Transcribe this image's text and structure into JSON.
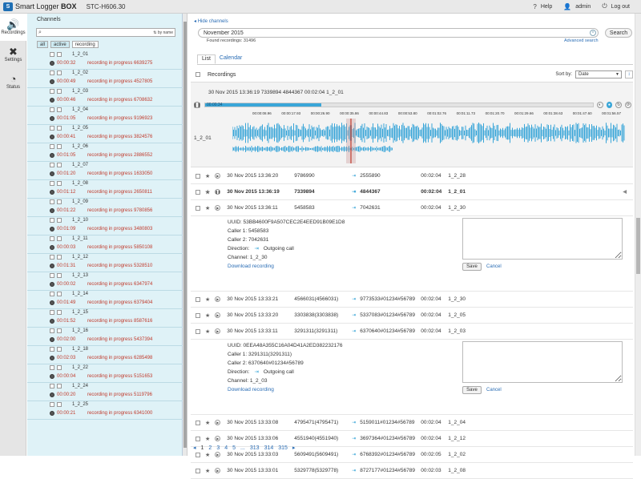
{
  "header": {
    "brand_a": "Smart Logger",
    "brand_b": "BOX",
    "model": "STC-H606.30",
    "help": "Help",
    "user": "admin",
    "logout": "Log out"
  },
  "nav": [
    {
      "label": "Recordings",
      "icon": "speaker-icon"
    },
    {
      "label": "Settings",
      "icon": "tools-icon"
    },
    {
      "label": "Status",
      "icon": "gauge-icon"
    }
  ],
  "channels": {
    "title": "Channels",
    "search_placeholder": "",
    "sort_label": "by name",
    "filters": [
      "all",
      "active",
      "recording"
    ],
    "items": [
      {
        "name": "1_2_01",
        "time": "00:00:32",
        "status": "recording in progress",
        "number": "6639275"
      },
      {
        "name": "1_2_02",
        "time": "00:00:49",
        "status": "recording in progress",
        "number": "4527805"
      },
      {
        "name": "1_2_03",
        "time": "00:00:46",
        "status": "recording in progress",
        "number": "6708632"
      },
      {
        "name": "1_2_04",
        "time": "00:01:05",
        "status": "recording in progress",
        "number": "9196923"
      },
      {
        "name": "1_2_05",
        "time": "00:00:41",
        "status": "recording in progress",
        "number": "3824576"
      },
      {
        "name": "1_2_06",
        "time": "00:01:05",
        "status": "recording in progress",
        "number": "2886552"
      },
      {
        "name": "1_2_07",
        "time": "00:01:20",
        "status": "recording in progress",
        "number": "1633050"
      },
      {
        "name": "1_2_08",
        "time": "00:01:12",
        "status": "recording in progress",
        "number": "2650811"
      },
      {
        "name": "1_2_09",
        "time": "00:01:22",
        "status": "recording in progress",
        "number": "9780856"
      },
      {
        "name": "1_2_10",
        "time": "00:01:09",
        "status": "recording in progress",
        "number": "3480803"
      },
      {
        "name": "1_2_11",
        "time": "00:00:03",
        "status": "recording in progress",
        "number": "5850108"
      },
      {
        "name": "1_2_12",
        "time": "00:01:31",
        "status": "recording in progress",
        "number": "5328510"
      },
      {
        "name": "1_2_13",
        "time": "00:00:02",
        "status": "recording in progress",
        "number": "6347974"
      },
      {
        "name": "1_2_14",
        "time": "00:01:49",
        "status": "recording in progress",
        "number": "6379404"
      },
      {
        "name": "1_2_15",
        "time": "00:01:52",
        "status": "recording in progress",
        "number": "8587616"
      },
      {
        "name": "1_2_16",
        "time": "00:02:00",
        "status": "recording in progress",
        "number": "5437394"
      },
      {
        "name": "1_2_18",
        "time": "00:02:03",
        "status": "recording in progress",
        "number": "6285498"
      },
      {
        "name": "1_2_22",
        "time": "00:00:04",
        "status": "recording in progress",
        "number": "5151653"
      },
      {
        "name": "1_2_24",
        "time": "00:00:20",
        "status": "recording in progress",
        "number": "5119796"
      },
      {
        "name": "1_2_25",
        "time": "00:00:21",
        "status": "recording in progress",
        "number": "6341000"
      }
    ]
  },
  "main": {
    "hide_channels": "Hide channels",
    "search_value": "November 2015",
    "search_button": "Search",
    "found": "Found recordings: 31496",
    "advanced": "Advanced search",
    "tabs": [
      "List",
      "Calendar"
    ],
    "recordings_label": "Recordings",
    "sort_label": "Sort by:",
    "sort_value": "Date"
  },
  "player": {
    "info": "30 Nov 2015 13:36:19 7339894 4844367 00:02:04 1_2_01",
    "current_time": "00:00:34",
    "progress": 0.3,
    "channel": "1_2_01",
    "ticks": [
      "00:00:08.96",
      "00:00:17.93",
      "00:00:26.90",
      "00:00:35.86",
      "00:00:44.83",
      "00:00:53.80",
      "00:01:02.76",
      "00:01:11.73",
      "00:01:20.70",
      "00:01:29.66",
      "00:01:38.63",
      "00:01:47.60",
      "00:01:56.57"
    ]
  },
  "rows_top": [
    {
      "date": "30 Nov 2015 13:36:20",
      "caller1": "9786990",
      "caller2": "2555890",
      "duration": "00:02:04",
      "channel": "1_2_28",
      "bold": false
    },
    {
      "date": "30 Nov 2015 13:36:19",
      "caller1": "7339894",
      "caller2": "4844367",
      "duration": "00:02:04",
      "channel": "1_2_01",
      "bold": true
    },
    {
      "date": "30 Nov 2015 13:36:11",
      "caller1": "5458583",
      "caller2": "7042631",
      "duration": "00:02:04",
      "channel": "1_2_30",
      "bold": false
    }
  ],
  "detail1": {
    "uuid": "UUID: 53BB4600F9A507CEC2E4EED91B09E1D8",
    "caller1": "Caller 1: 5458583",
    "caller2": "Caller 2: 7042631",
    "direction_label": "Direction:",
    "direction_value": "Outgoing call",
    "channel": "Channel: 1_2_30",
    "download": "Download recording",
    "save": "Save",
    "cancel": "Cancel"
  },
  "rows_mid": [
    {
      "date": "30 Nov 2015 13:33:21",
      "caller1": "4566031(4566031)",
      "caller2": "9773533#01234#56789",
      "duration": "00:02:04",
      "channel": "1_2_30"
    },
    {
      "date": "30 Nov 2015 13:33:20",
      "caller1": "3303838(3303838)",
      "caller2": "5337083#01234#56789",
      "duration": "00:02:04",
      "channel": "1_2_05"
    },
    {
      "date": "30 Nov 2015 13:33:11",
      "caller1": "3291311(3291311)",
      "caller2": "6370640#01234#56789",
      "duration": "00:02:04",
      "channel": "1_2_03"
    }
  ],
  "detail2": {
    "uuid": "UUID: 0EEA48A355C16A04D41A2ED382232176",
    "caller1": "Caller 1: 3291311(3291311)",
    "caller2": "Caller 2: 6370640#01234#56789",
    "direction_label": "Direction:",
    "direction_value": "Outgoing call",
    "channel": "Channel: 1_2_03",
    "download": "Download recording",
    "save": "Save",
    "cancel": "Cancel"
  },
  "rows_bottom": [
    {
      "date": "30 Nov 2015 13:33:08",
      "caller1": "4795471(4795471)",
      "caller2": "5159011#01234#56789",
      "duration": "00:02:04",
      "channel": "1_2_04"
    },
    {
      "date": "30 Nov 2015 13:33:06",
      "caller1": "4551940(4551940)",
      "caller2": "3697364#01234#56789",
      "duration": "00:02:04",
      "channel": "1_2_12"
    },
    {
      "date": "30 Nov 2015 13:33:03",
      "caller1": "5609491(5609491)",
      "caller2": "6768392#01234#56789",
      "duration": "00:02:05",
      "channel": "1_2_02"
    },
    {
      "date": "30 Nov 2015 13:33:01",
      "caller1": "5329778(5329778)",
      "caller2": "8727177#01234#56789",
      "duration": "00:02:03",
      "channel": "1_2_08"
    }
  ],
  "pager": {
    "prev": "◂",
    "pages": [
      "1",
      "2",
      "3",
      "4",
      "5",
      "...",
      "313",
      "314",
      "315"
    ],
    "next": "▸"
  }
}
